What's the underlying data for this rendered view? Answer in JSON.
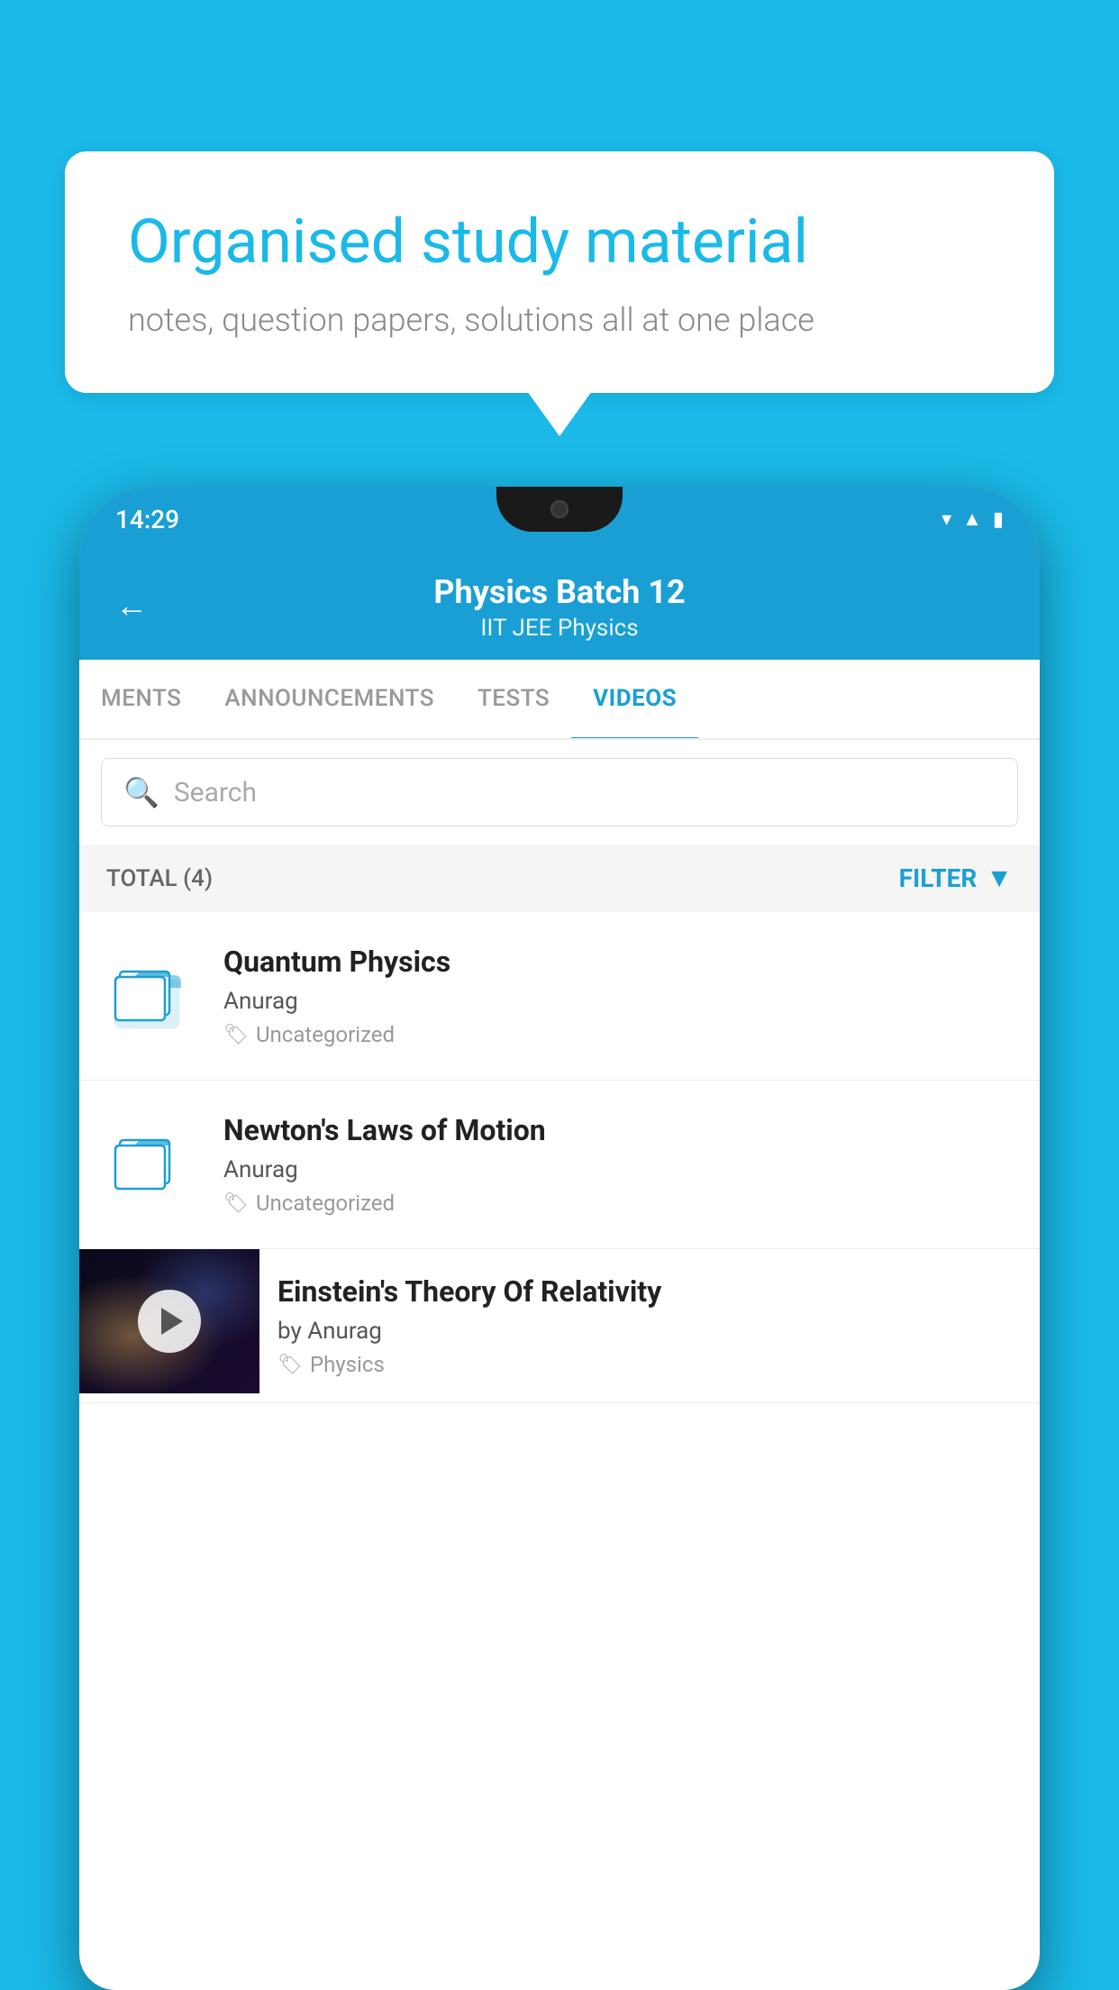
{
  "background": {
    "color": "#1ab9e8"
  },
  "speech_bubble": {
    "headline": "Organised study material",
    "subtext": "notes, question papers, solutions all at one place"
  },
  "phone": {
    "status_bar": {
      "time": "14:29"
    },
    "header": {
      "back_label": "←",
      "title": "Physics Batch 12",
      "subtitle": "IIT JEE   Physics"
    },
    "tabs": [
      {
        "label": "MENTS",
        "active": false
      },
      {
        "label": "ANNOUNCEMENTS",
        "active": false
      },
      {
        "label": "TESTS",
        "active": false
      },
      {
        "label": "VIDEOS",
        "active": true
      }
    ],
    "search": {
      "placeholder": "Search"
    },
    "filter_row": {
      "total_label": "TOTAL (4)",
      "filter_label": "FILTER"
    },
    "videos": [
      {
        "id": 1,
        "title": "Quantum Physics",
        "author": "Anurag",
        "tag": "Uncategorized",
        "has_thumbnail": false
      },
      {
        "id": 2,
        "title": "Newton's Laws of Motion",
        "author": "Anurag",
        "tag": "Uncategorized",
        "has_thumbnail": false
      },
      {
        "id": 3,
        "title": "Einstein's Theory Of Relativity",
        "author": "by Anurag",
        "tag": "Physics",
        "has_thumbnail": true
      }
    ]
  }
}
